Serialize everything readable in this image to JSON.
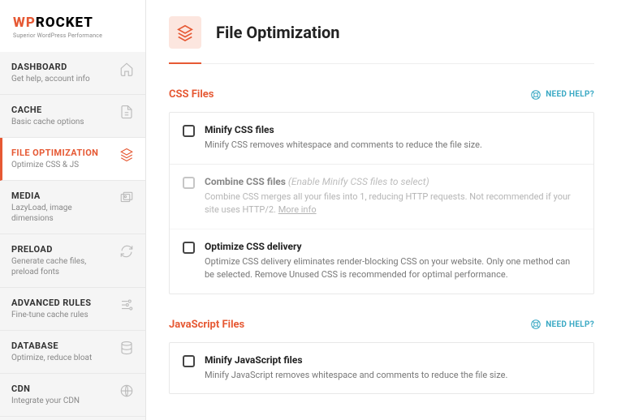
{
  "logo": {
    "part1": "WP",
    "part2": "ROCKET",
    "tagline": "Superior WordPress Performance"
  },
  "nav": {
    "dashboard": {
      "title": "DASHBOARD",
      "sub": "Get help, account info"
    },
    "cache": {
      "title": "CACHE",
      "sub": "Basic cache options"
    },
    "fileopt": {
      "title": "FILE OPTIMIZATION",
      "sub": "Optimize CSS & JS"
    },
    "media": {
      "title": "MEDIA",
      "sub": "LazyLoad, image dimensions"
    },
    "preload": {
      "title": "PRELOAD",
      "sub": "Generate cache files, preload fonts"
    },
    "advanced": {
      "title": "ADVANCED RULES",
      "sub": "Fine-tune cache rules"
    },
    "database": {
      "title": "DATABASE",
      "sub": "Optimize, reduce bloat"
    },
    "cdn": {
      "title": "CDN",
      "sub": "Integrate your CDN"
    }
  },
  "page": {
    "title": "File Optimization"
  },
  "help": {
    "label": "NEED HELP?"
  },
  "css": {
    "heading": "CSS Files",
    "minify": {
      "title": "Minify CSS files",
      "desc": "Minify CSS removes whitespace and comments to reduce the file size."
    },
    "combine": {
      "title": "Combine CSS files ",
      "note": "(Enable Minify CSS files to select)",
      "desc": "Combine CSS merges all your files into 1, reducing HTTP requests. Not recommended if your site uses HTTP/2. ",
      "more": "More info"
    },
    "optimize": {
      "title": "Optimize CSS delivery",
      "desc": "Optimize CSS delivery eliminates render-blocking CSS on your website. Only one method can be selected. Remove Unused CSS is recommended for optimal performance."
    }
  },
  "js": {
    "heading": "JavaScript Files",
    "minify": {
      "title": "Minify JavaScript files",
      "desc": "Minify JavaScript removes whitespace and comments to reduce the file size."
    }
  }
}
